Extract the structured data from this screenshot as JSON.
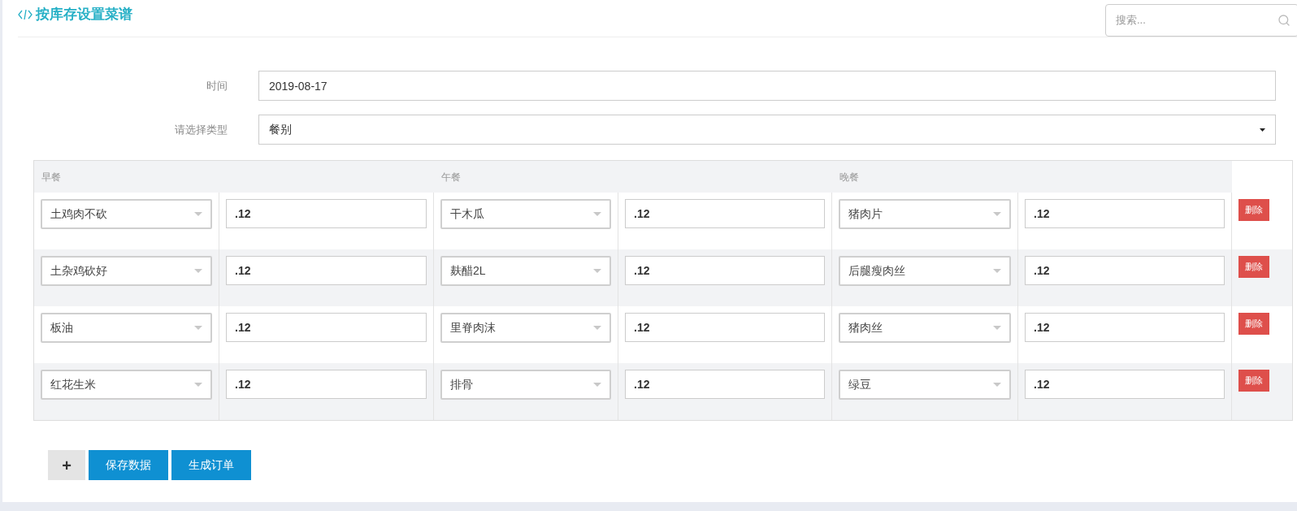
{
  "title": "按库存设置菜谱",
  "search": {
    "placeholder": "搜索..."
  },
  "form": [
    {
      "label": "时间",
      "kind": "input",
      "value": "2019-08-17"
    },
    {
      "label": "请选择类型",
      "kind": "select",
      "value": "餐别"
    }
  ],
  "table": {
    "columns": [
      "早餐",
      "午餐",
      "晚餐"
    ],
    "rows": [
      {
        "items": [
          {
            "name": "土鸡肉不砍",
            "qty": ".12"
          },
          {
            "name": "干木瓜",
            "qty": ".12"
          },
          {
            "name": "猪肉片",
            "qty": ".12"
          }
        ],
        "action": "删除"
      },
      {
        "items": [
          {
            "name": "土杂鸡砍好",
            "qty": ".12"
          },
          {
            "name": "麸醋2L",
            "qty": ".12"
          },
          {
            "name": "后腿瘦肉丝",
            "qty": ".12"
          }
        ],
        "action": "删除"
      },
      {
        "items": [
          {
            "name": "板油",
            "qty": ".12"
          },
          {
            "name": "里脊肉沫",
            "qty": ".12"
          },
          {
            "name": "猪肉丝",
            "qty": ".12"
          }
        ],
        "action": "删除"
      },
      {
        "items": [
          {
            "name": "红花生米",
            "qty": ".12"
          },
          {
            "name": "排骨",
            "qty": ".12"
          },
          {
            "name": "绿豆",
            "qty": ".12"
          }
        ],
        "action": "删除"
      }
    ]
  },
  "buttons": [
    {
      "kind": "add",
      "label": "+"
    },
    {
      "kind": "primary",
      "label": "保存数据"
    },
    {
      "kind": "primary",
      "label": "生成订单"
    }
  ]
}
